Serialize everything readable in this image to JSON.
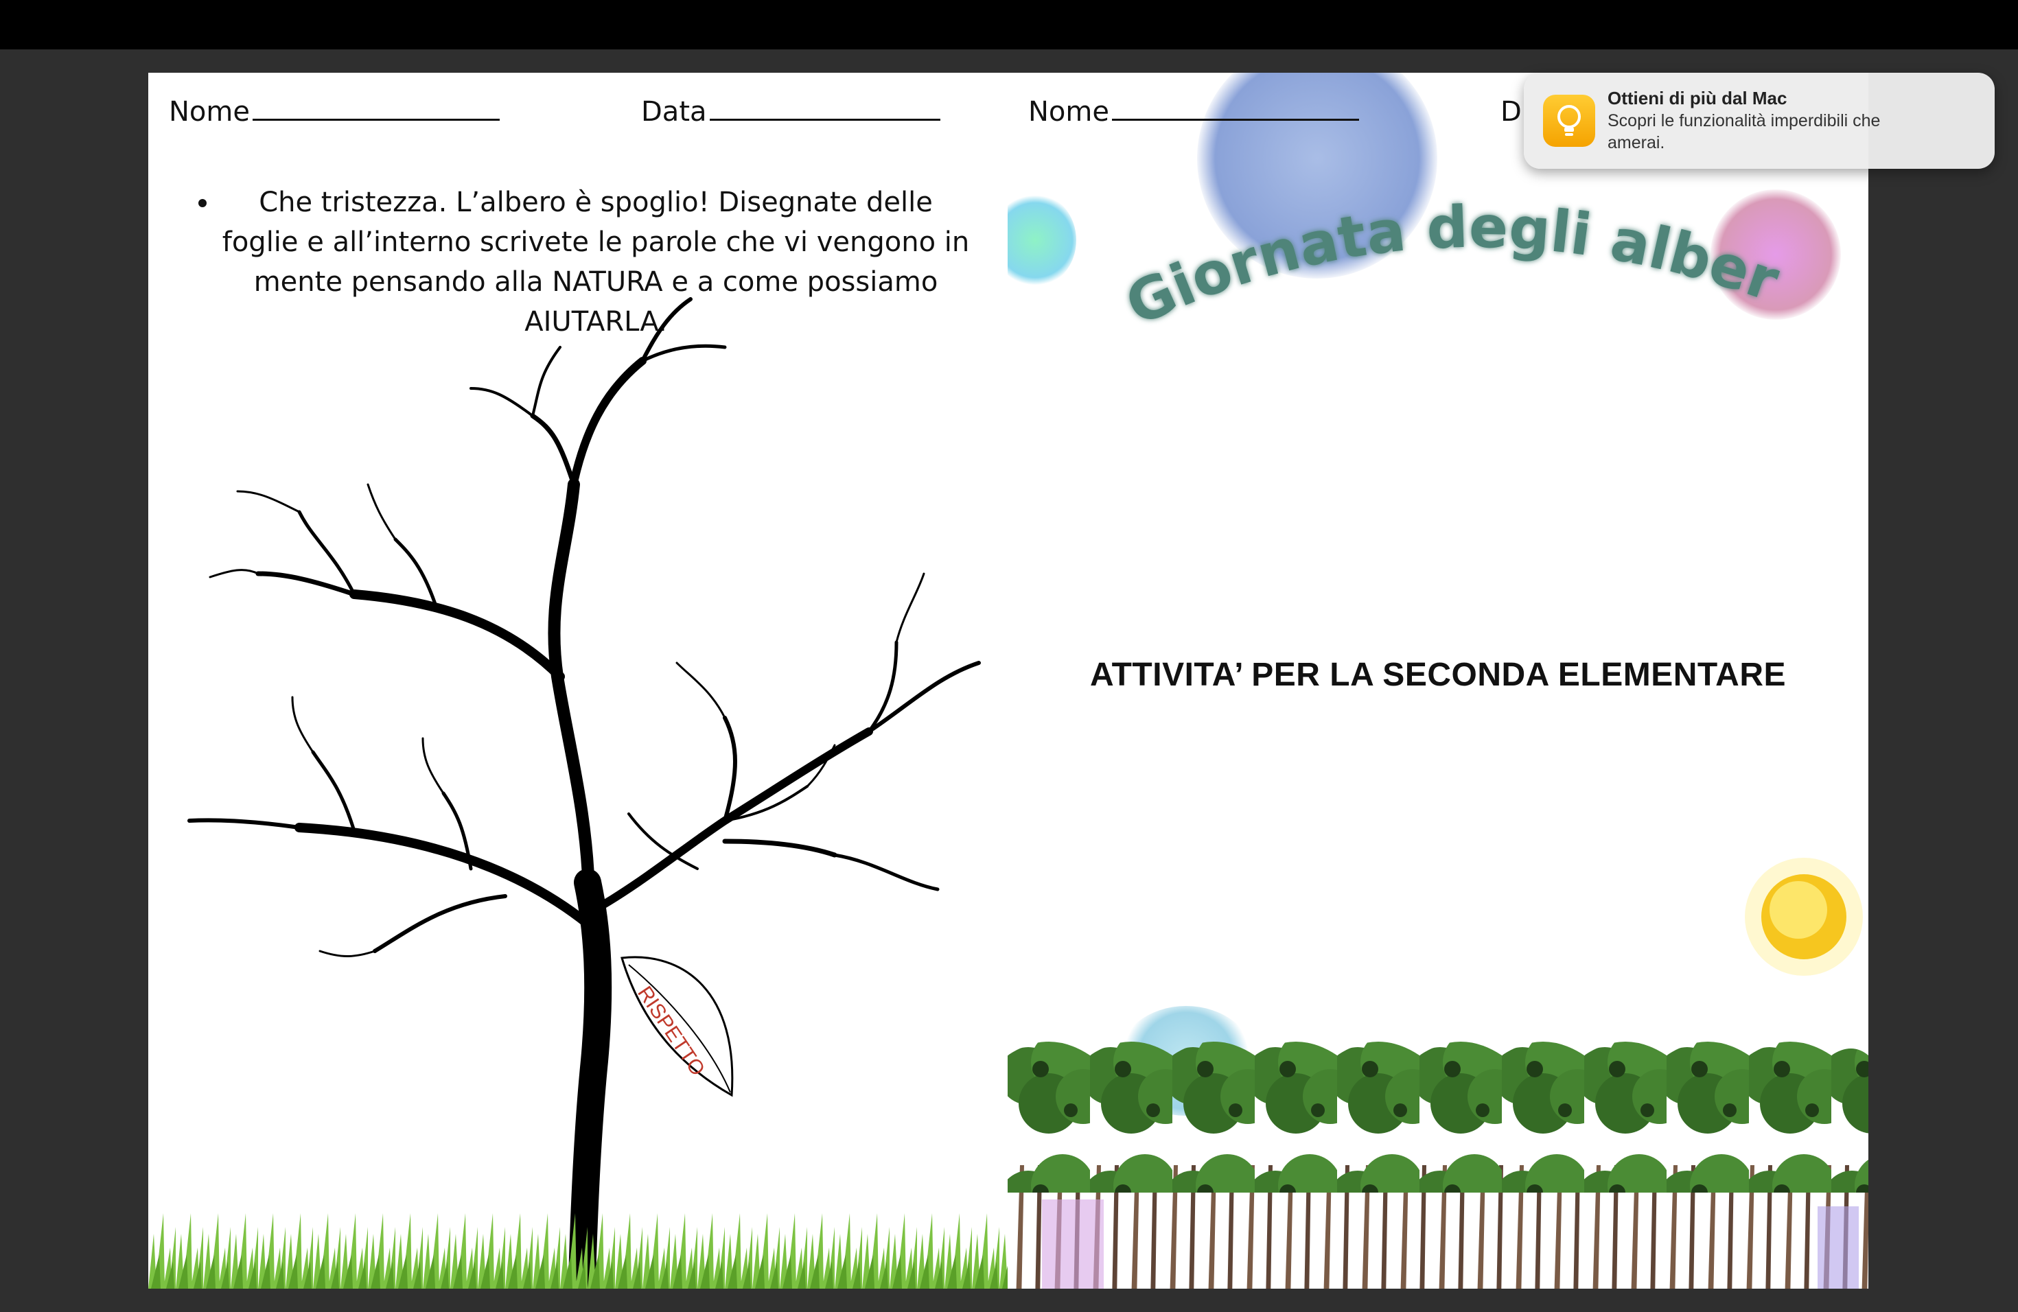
{
  "left_page": {
    "fields": [
      {
        "label": "Nome"
      },
      {
        "label": "Data"
      }
    ],
    "instruction": "Che tristezza. L’albero è spoglio! Disegnate delle foglie e all’interno scrivete le parole che vi vengono in mente pensando alla NATURA e a come possiamo AIUTARLA.",
    "leaf_word": "RISPETTO"
  },
  "right_page": {
    "fields": [
      {
        "label": "Nome"
      },
      {
        "label": "D"
      }
    ],
    "title": "Giornata degli alberi",
    "activity": "ATTIVITA’ PER LA SECONDA ELEMENTARE"
  },
  "notification": {
    "title": "Ottieni di più dal Mac",
    "body": "Scopri le funzionalità imperdibili che amerai.",
    "icon": "lightbulb-icon"
  },
  "colors": {
    "title_teal": "#4f8479",
    "leaf_text_red": "#c0392b",
    "tree_green": "#3f7a2c",
    "grass_green": "#7cc242"
  }
}
